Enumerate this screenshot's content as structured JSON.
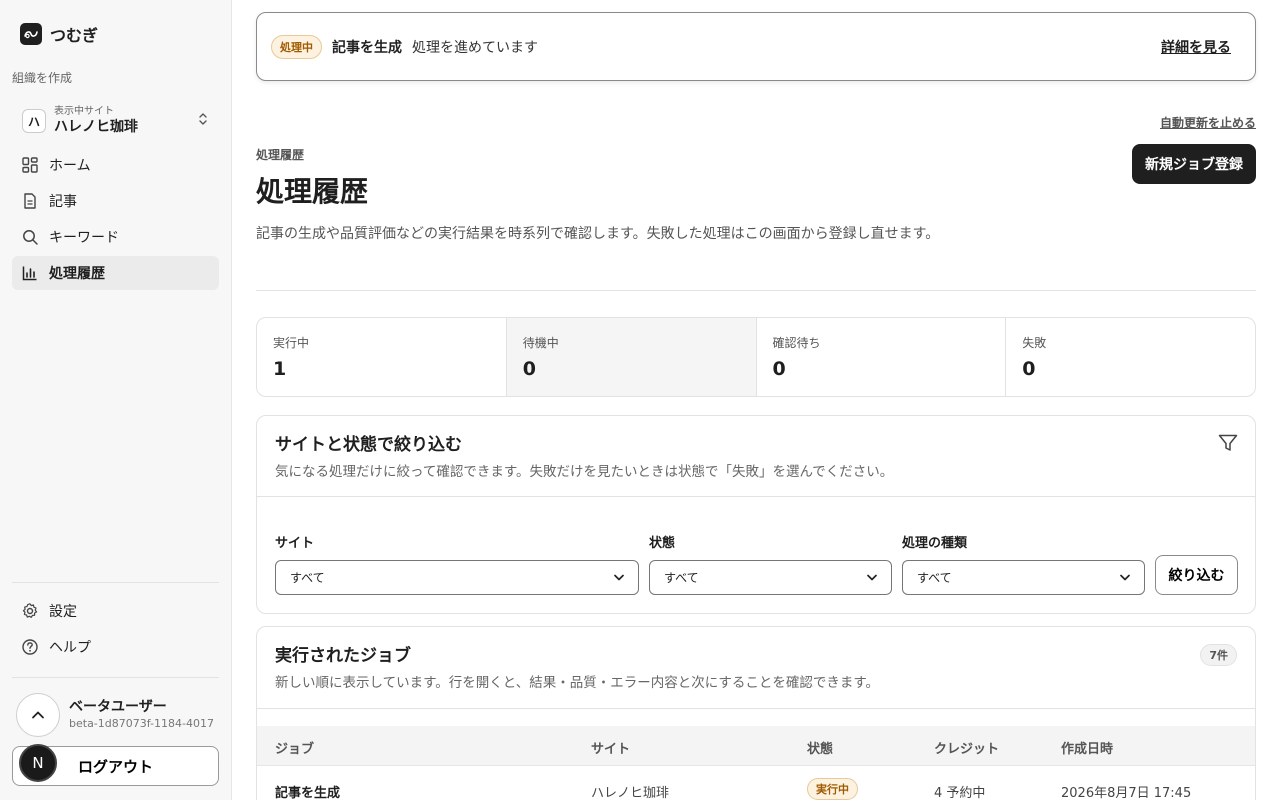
{
  "app": {
    "name": "つむぎ",
    "logo_icon": "tsumugi-logo-icon"
  },
  "sidebar": {
    "org_create": "組織を作成",
    "site_switcher": {
      "caption": "表示中サイト",
      "initial": "ハ",
      "name": "ハレノヒ珈琲"
    },
    "nav": [
      {
        "label": "ホーム",
        "icon": "home-grid-icon",
        "active": false
      },
      {
        "label": "記事",
        "icon": "document-icon",
        "active": false
      },
      {
        "label": "キーワード",
        "icon": "search-icon",
        "active": false
      },
      {
        "label": "処理履歴",
        "icon": "bar-chart-icon",
        "active": true
      }
    ],
    "bottom": [
      {
        "label": "設定",
        "icon": "gear-icon"
      },
      {
        "label": "ヘルプ",
        "icon": "help-icon"
      }
    ],
    "user": {
      "name": "ベータユーザー",
      "id": "beta-1d87073f-1184-4017"
    },
    "avatar_initial": "N",
    "logout_label": "ログアウト"
  },
  "banner": {
    "status": "処理中",
    "title": "記事を生成",
    "message": "処理を進めています",
    "link": "詳細を見る"
  },
  "header": {
    "auto_refresh_stop": "自動更新を止める",
    "breadcrumb": "処理履歴",
    "title": "処理履歴",
    "new_job_button": "新規ジョブ登録",
    "description": "記事の生成や品質評価などの実行結果を時系列で確認します。失敗した処理はこの画面から登録し直せます。"
  },
  "stats": [
    {
      "label": "実行中",
      "value": "1"
    },
    {
      "label": "待機中",
      "value": "0"
    },
    {
      "label": "確認待ち",
      "value": "0"
    },
    {
      "label": "失敗",
      "value": "0"
    }
  ],
  "filter": {
    "title": "サイトと状態で絞り込む",
    "subtitle": "気になる処理だけに絞って確認できます。失敗だけを見たいときは状態で「失敗」を選んでください。",
    "fields": [
      {
        "label": "サイト",
        "value": "すべて"
      },
      {
        "label": "状態",
        "value": "すべて"
      },
      {
        "label": "処理の種類",
        "value": "すべて"
      }
    ],
    "button": "絞り込む"
  },
  "jobs": {
    "title": "実行されたジョブ",
    "subtitle": "新しい順に表示しています。行を開くと、結果・品質・エラー内容と次にすることを確認できます。",
    "count": "7件",
    "columns": [
      "ジョブ",
      "サイト",
      "状態",
      "クレジット",
      "作成日時"
    ],
    "rows": [
      {
        "job": "記事を生成",
        "site": "ハレノヒ珈琲",
        "status": "実行中",
        "credit": "4 予約中",
        "created": "2026年8月7日 17:45"
      }
    ]
  },
  "colors": {
    "accent": "#1f1f1f",
    "running_badge_bg": "#fdf2e0",
    "running_badge_text": "#a05a00"
  }
}
